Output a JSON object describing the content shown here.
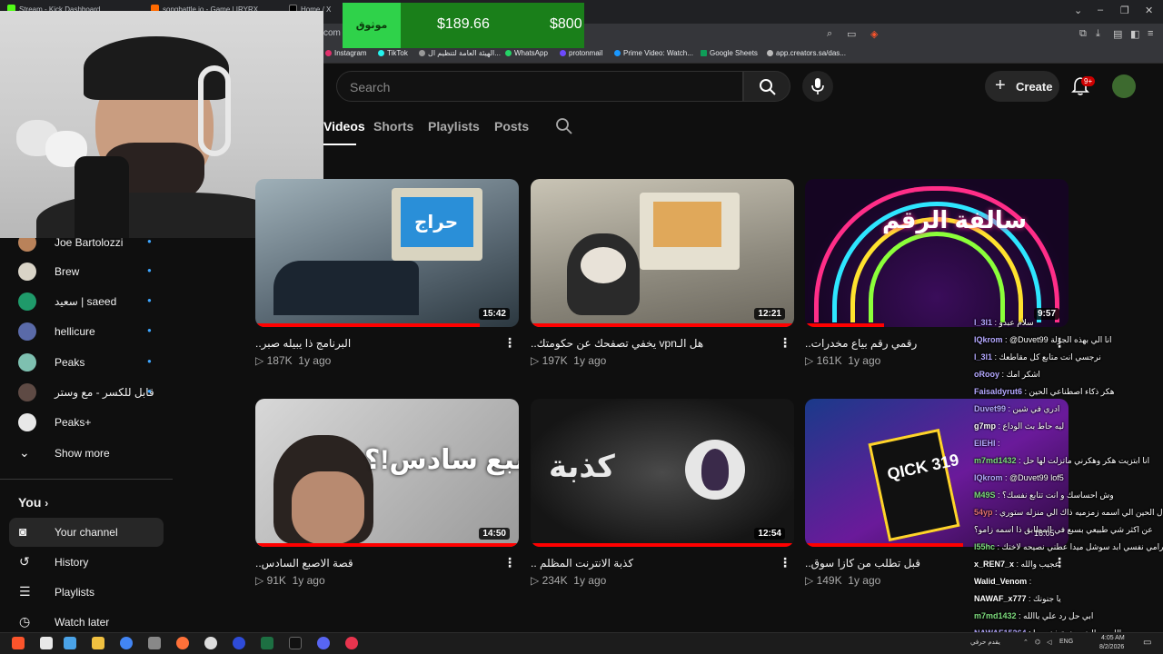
{
  "browser": {
    "tabs": [
      "Stream - Kick Dashboard",
      "songbattle.io - Game | IRYRX",
      "Home / X"
    ],
    "url": "com",
    "bookmarks": [
      "Instagram",
      "TikTok",
      "الهيئة العامة لتنظيم ال...",
      "WhatsApp",
      "protonmail",
      "Prime Video: Watch...",
      "Google Sheets",
      "app.creators.sa/das..."
    ]
  },
  "ticker": {
    "label": "موثوق",
    "price_1": "$189.66",
    "price_2": "$800"
  },
  "header": {
    "search_placeholder": "Search",
    "create_label": "Create",
    "notif_badge": "9+"
  },
  "channel_tabs": [
    {
      "label": "Videos",
      "active": true
    },
    {
      "label": "Shorts",
      "active": false
    },
    {
      "label": "Playlists",
      "active": false
    },
    {
      "label": "Posts",
      "active": false
    }
  ],
  "sidebar": {
    "subscriptions": [
      {
        "name": "Joe Bartolozzi",
        "color": "#b9825a"
      },
      {
        "name": "Brew",
        "color": "#d9d4c7"
      },
      {
        "name": "سعيد | saeed",
        "color": "#1f9a6a"
      },
      {
        "name": "hellicure",
        "color": "#5a6aa8"
      },
      {
        "name": "Peaks",
        "color": "#7ec0b0"
      },
      {
        "name": "قابل للكسر - مع وستر",
        "color": "#5e4a44"
      },
      {
        "name": "Peaks+",
        "color": "#e8e8e8"
      }
    ],
    "show_more": "Show more",
    "you_heading": "You",
    "you_items": [
      {
        "label": "Your channel",
        "icon": "user-square-icon",
        "selected": true
      },
      {
        "label": "History",
        "icon": "history-icon",
        "selected": false
      },
      {
        "label": "Playlists",
        "icon": "playlists-icon",
        "selected": false
      },
      {
        "label": "Watch later",
        "icon": "clock-icon",
        "selected": false
      }
    ]
  },
  "videos": [
    {
      "title": "البرنامج ذا يبيله صبر..",
      "views": "187K",
      "age": "1y ago",
      "duration": "15:42",
      "watched": 0.85,
      "thumb_text": "حراج"
    },
    {
      "title": "هل الـvpn يخفي تصفحك عن حكومتك..",
      "views": "197K",
      "age": "1y ago",
      "duration": "12:21",
      "watched": 1.0,
      "thumb_text": ""
    },
    {
      "title": "رقمي رقم بياع مخدرات..",
      "views": "161K",
      "age": "1y ago",
      "duration": "9:57",
      "watched": 0.3,
      "thumb_text": "سالفة الرقم"
    },
    {
      "title": "قصة الاصبع السادس..",
      "views": "91K",
      "age": "1y ago",
      "duration": "14:50",
      "watched": 1.0,
      "thumb_text": "أصبع سادس!؟"
    },
    {
      "title": "كذبة الانترنت المظلم ..",
      "views": "234K",
      "age": "1y ago",
      "duration": "12:54",
      "watched": 1.0,
      "thumb_text": "كذبة"
    },
    {
      "title": "قبل تطلب من كازا سوق..",
      "views": "149K",
      "age": "1y ago",
      "duration": "",
      "watched": 0.6,
      "thumb_text": "QICK 319"
    }
  ],
  "chat": [
    {
      "user": "l_3l1",
      "text": "سلام عبدو",
      "color": "#b4a8ff"
    },
    {
      "user": "IQkrom",
      "text": "@Duvet99 انا الي بهذه الجولة",
      "color": "#b4a8ff"
    },
    {
      "user": "l_3l1",
      "text": "نرجسي انت متابع كل مقاطعك",
      "color": "#b4a8ff"
    },
    {
      "user": "oRooy",
      "text": "اشكر امك",
      "color": "#b4a8ff"
    },
    {
      "user": "Faisaldyrut6",
      "text": "هكر ذكاء اصطناعي الحين",
      "color": "#b4a8ff"
    },
    {
      "user": "Duvet99",
      "text": "ادري في شين",
      "color": "#b4a8ff"
    },
    {
      "user": "g7mp",
      "text": "ليه حاط بث الوداع",
      "color": "#ffffff"
    },
    {
      "user": "EIEHI",
      "text": "",
      "color": "#b4a8ff"
    },
    {
      "user": "m7md1432",
      "text": "انا ابتزيت هكر وهكرني ماتزلت لها حل",
      "color": "#7ddc7d"
    },
    {
      "user": "IQkrom",
      "text": "@Duvet99 lof5",
      "color": "#b4a8ff"
    },
    {
      "user": "M49S",
      "text": "وش احساسك و انت تتابع نفسك؟",
      "color": "#7ddc7d"
    },
    {
      "user": "54yp",
      "text": "سؤال الحين الي اسمه زمزميه ذاك الي منزله ستوري",
      "color": "#e07070"
    },
    {
      "user": "",
      "text": "عن اكثر شي طبيعي بسبع في المطابق ذا اسمه زامو؟",
      "color": "#ffffff"
    },
    {
      "user": "l55hc",
      "text": "رامي نفسي ابد سوشل ميدا عطني نصيحه لاختك",
      "color": "#7ddc7d"
    },
    {
      "user": "x_REN7_x",
      "text": "عجيب والله",
      "color": "#ffffff"
    },
    {
      "user": "Walid_Venom",
      "text": "",
      "color": "#ffffff"
    },
    {
      "user": "NAWAF_x777",
      "text": "يا جنونك",
      "color": "#ffffff"
    },
    {
      "user": "m7md1432",
      "text": "ابي حل رد علي باالله",
      "color": "#7ddc7d"
    },
    {
      "user": "NAWAF15264",
      "text": "والله سواليف رهيبة ذهب ما",
      "color": "#b4a8ff"
    }
  ],
  "chat_timestamp": "16:05",
  "taskbar": {
    "lang": "ENG",
    "time": "4:05 AM",
    "date": "8/2/2026",
    "ime": "يقدم حرفي"
  }
}
